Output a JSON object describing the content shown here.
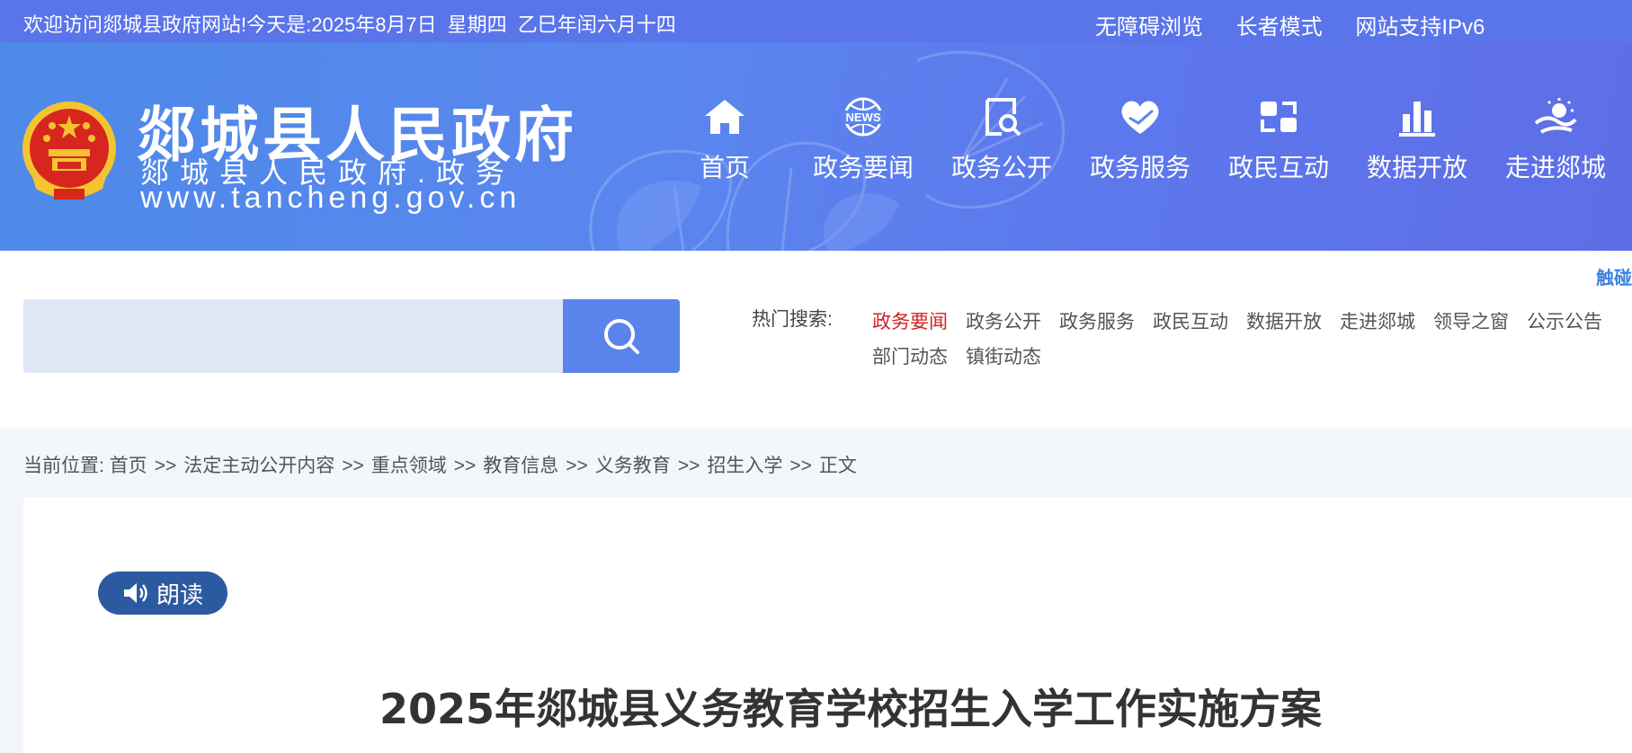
{
  "topbar": {
    "welcome": "欢迎访问郯城县政府网站!",
    "today_label": "今天是:",
    "date": "2025年8月7日",
    "weekday": "星期四",
    "lunar": "乙巳年闰六月十四",
    "links": [
      "无障碍浏览",
      "长者模式",
      "网站支持IPv6"
    ]
  },
  "header": {
    "title": "郯城县人民政府",
    "subtitle": "郯城县人民政府.政务",
    "url": "www.tancheng.gov.cn",
    "nav": [
      {
        "label": "首页",
        "icon": "home-icon"
      },
      {
        "label": "政务要闻",
        "icon": "news-icon",
        "icon_text": "NEWS"
      },
      {
        "label": "政务公开",
        "icon": "document-search-icon"
      },
      {
        "label": "政务服务",
        "icon": "heart-hand-icon"
      },
      {
        "label": "政民互动",
        "icon": "interaction-icon"
      },
      {
        "label": "数据开放",
        "icon": "bar-chart-icon"
      },
      {
        "label": "走进郯城",
        "icon": "landscape-icon"
      }
    ]
  },
  "search": {
    "placeholder": "",
    "touch_label": "触碰",
    "hot_label": "热门搜索:",
    "hot_items": [
      "政务要闻",
      "政务公开",
      "政务服务",
      "政民互动",
      "数据开放",
      "走进郯城",
      "领导之窗",
      "公示公告",
      "部门动态",
      "镇街动态"
    ],
    "active_color": "#d0241f"
  },
  "breadcrumb": {
    "label": "当前位置:",
    "items": [
      "首页",
      "法定主动公开内容",
      "重点领域",
      "教育信息",
      "义务教育",
      "招生入学",
      "正文"
    ],
    "separator": ">>"
  },
  "article": {
    "read_label": "朗读",
    "title": "2025年郯城县义务教育学校招生入学工作实施方案"
  },
  "colors": {
    "topbar": "#5a74ea",
    "header_start": "#4d8ae8",
    "header_end": "#5e6ee6",
    "search_button": "#5b83ec",
    "read_button": "#2c5aa0"
  }
}
